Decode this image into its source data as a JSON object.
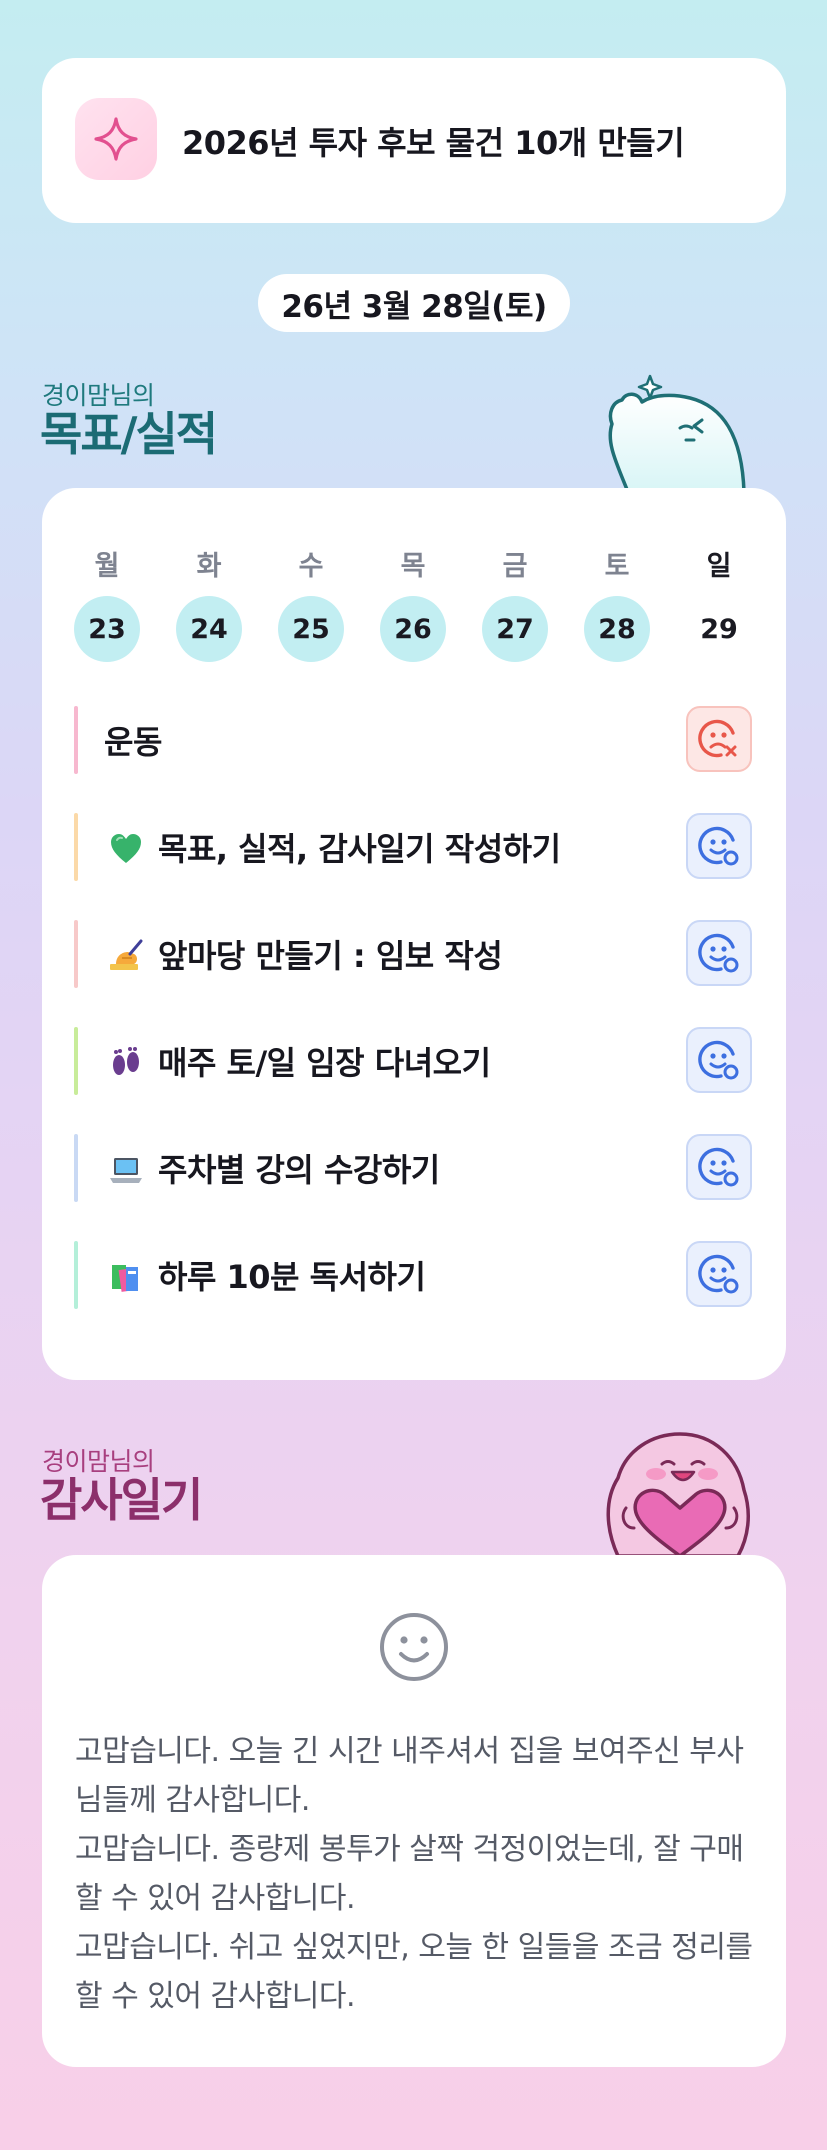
{
  "goal_banner": {
    "icon": "sparkle-icon",
    "text": "2026년 투자 후보 물건 10개 만들기"
  },
  "date_label": "26년 3월 28일(토)",
  "goals_section": {
    "subtitle": "경이맘님의",
    "title": "목표/실적"
  },
  "week": {
    "days": [
      {
        "label": "월",
        "num": "23",
        "filled": true
      },
      {
        "label": "화",
        "num": "24",
        "filled": true
      },
      {
        "label": "수",
        "num": "25",
        "filled": true
      },
      {
        "label": "목",
        "num": "26",
        "filled": true
      },
      {
        "label": "금",
        "num": "27",
        "filled": true
      },
      {
        "label": "토",
        "num": "28",
        "filled": true
      },
      {
        "label": "일",
        "num": "29",
        "filled": false
      }
    ]
  },
  "tasks": [
    {
      "emoji": "",
      "label": "운동",
      "status": "missed",
      "bar_color": "#f7b8cf"
    },
    {
      "emoji": "green-heart",
      "label": "목표, 실적, 감사일기 작성하기",
      "status": "done",
      "bar_color": "#fbd9a8"
    },
    {
      "emoji": "writing-hand",
      "label": "앞마당 만들기 : 임보 작성",
      "status": "done",
      "bar_color": "#f7c9c9"
    },
    {
      "emoji": "footprints",
      "label": "매주 토/일 임장 다녀오기",
      "status": "done",
      "bar_color": "#c8ec9a"
    },
    {
      "emoji": "laptop",
      "label": "주차별 강의 수강하기",
      "status": "done",
      "bar_color": "#c9d9f4"
    },
    {
      "emoji": "books",
      "label": "하루 10분 독서하기",
      "status": "done",
      "bar_color": "#b4efd9"
    }
  ],
  "diary_section": {
    "subtitle": "경이맘님의",
    "title": "감사일기"
  },
  "diary": {
    "mood_icon": "smile-face-icon",
    "lines": [
      "고맙습니다. 오늘 긴 시간 내주셔서 집을 보여주신 부사님들께 감사합니다.",
      "고맙습니다. 종량제 봉투가 살짝 걱정이었는데, 잘 구매할 수 있어 감사합니다.",
      "고맙습니다. 쉬고 싶었지만, 오늘 한 일들을 조금 정리를 할 수 있어 감사합니다."
    ]
  },
  "colors": {
    "accent_teal": "#1b6b74",
    "accent_pink": "#8c2f6b",
    "done_icon": "#3d6fe0",
    "missed_icon": "#e8574a"
  }
}
